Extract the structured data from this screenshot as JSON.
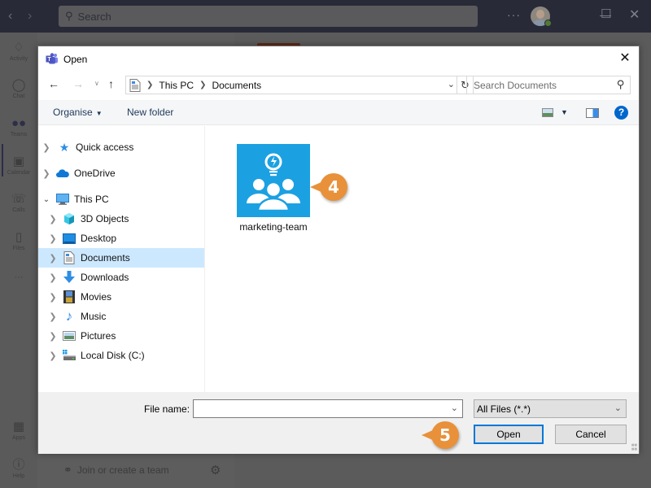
{
  "teams": {
    "search_placeholder": "Search",
    "more_label": "···",
    "rail": [
      {
        "label": "Activity",
        "icon": "bell-icon"
      },
      {
        "label": "Chat",
        "icon": "chat-icon"
      },
      {
        "label": "Teams",
        "icon": "teams-icon"
      },
      {
        "label": "Calendar",
        "icon": "calendar-icon"
      },
      {
        "label": "Calls",
        "icon": "phone-icon"
      },
      {
        "label": "Files",
        "icon": "file-icon"
      },
      {
        "label": "···",
        "icon": "more-icon"
      },
      {
        "label": "Apps",
        "icon": "apps-icon"
      },
      {
        "label": "Help",
        "icon": "help-icon"
      }
    ],
    "join_team_label": "Join or create a team"
  },
  "dialog": {
    "title": "Open",
    "breadcrumb": [
      "This PC",
      "Documents"
    ],
    "search_placeholder": "Search Documents",
    "toolbar": {
      "organise_label": "Organise",
      "new_folder_label": "New folder"
    },
    "nav_tree": [
      {
        "label": "Quick access",
        "icon": "star-icon",
        "expanded": false,
        "level": 0
      },
      {
        "label": "OneDrive",
        "icon": "cloud-icon",
        "expanded": false,
        "level": 0
      },
      {
        "label": "This PC",
        "icon": "computer-icon",
        "expanded": true,
        "level": 0
      },
      {
        "label": "3D Objects",
        "icon": "cube-icon",
        "expanded": false,
        "level": 1
      },
      {
        "label": "Desktop",
        "icon": "desktop-icon",
        "expanded": false,
        "level": 1
      },
      {
        "label": "Documents",
        "icon": "document-icon",
        "expanded": false,
        "level": 1,
        "selected": true
      },
      {
        "label": "Downloads",
        "icon": "download-icon",
        "expanded": false,
        "level": 1
      },
      {
        "label": "Movies",
        "icon": "film-icon",
        "expanded": false,
        "level": 1
      },
      {
        "label": "Music",
        "icon": "music-icon",
        "expanded": false,
        "level": 1
      },
      {
        "label": "Pictures",
        "icon": "picture-icon",
        "expanded": false,
        "level": 1
      },
      {
        "label": "Local Disk (C:)",
        "icon": "drive-icon",
        "expanded": false,
        "level": 1
      }
    ],
    "files": [
      {
        "name": "marketing-team",
        "icon": "team-image-icon"
      }
    ],
    "file_name_label": "File name:",
    "file_name_value": "",
    "file_type_selected": "All Files (*.*)",
    "open_label": "Open",
    "cancel_label": "Cancel"
  },
  "callouts": [
    {
      "number": "4"
    },
    {
      "number": "5"
    }
  ],
  "colors": {
    "accent": "#0078d7",
    "selection": "#cce8ff",
    "callout": "#e8913a",
    "file_thumb": "#1ba1e2"
  }
}
